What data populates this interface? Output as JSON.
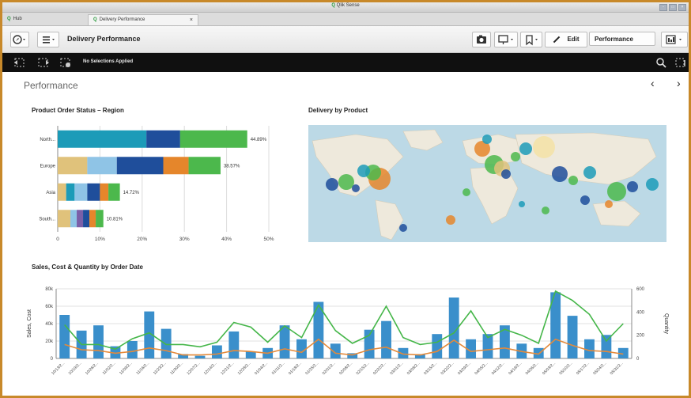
{
  "window": {
    "app_prefix": "Q",
    "app_title": "Qlik Sense",
    "controls": [
      "-",
      "□",
      "×"
    ]
  },
  "tabs": [
    {
      "icon": "Q",
      "label": "Hub"
    },
    {
      "icon": "Q",
      "label": "Delivery Performance",
      "close": "×"
    }
  ],
  "toolbar": {
    "sheet_name": "Delivery Performance",
    "edit_label": "Edit",
    "sheet_selector": "Performance"
  },
  "selections": {
    "message": "No Selections Applied"
  },
  "page": {
    "title": "Performance",
    "prev": "‹",
    "next": "›"
  },
  "colors": {
    "bar_blue": "#3a8fcb",
    "line_green": "#45b649",
    "line_orange": "#e58a3a",
    "segments": [
      "#1c9bb8",
      "#1f4e9b",
      "#4cb84c",
      "#e0c27b",
      "#8fc4e6",
      "#e5862b",
      "#7a5fa8"
    ]
  },
  "chart_data": [
    {
      "type": "bar",
      "orientation": "horizontal-stacked",
      "title": "Product Order Status – Region",
      "categories": [
        "North...",
        "Europe",
        "Asia",
        "South..."
      ],
      "totals_label": [
        "44.89%",
        "38.57%",
        "14.72%",
        "10.81%"
      ],
      "totals": [
        44.89,
        38.57,
        14.72,
        10.81
      ],
      "segments": [
        [
          21,
          8,
          15.89
        ],
        [
          7,
          7,
          11,
          6,
          7.57
        ],
        [
          2,
          2,
          3,
          3,
          2,
          2.72
        ],
        [
          3,
          1.5,
          1.5,
          1.5,
          1.5,
          1.81
        ]
      ],
      "segment_colors": [
        [
          "#1c9bb8",
          "#1f4e9b",
          "#4cb84c"
        ],
        [
          "#e0c27b",
          "#8fc4e6",
          "#1f4e9b",
          "#e5862b",
          "#4cb84c"
        ],
        [
          "#e0c27b",
          "#1c9bb8",
          "#8fc4e6",
          "#1f4e9b",
          "#e5862b",
          "#4cb84c"
        ],
        [
          "#e0c27b",
          "#8fc4e6",
          "#7a5fa8",
          "#1f4e9b",
          "#e5862b",
          "#4cb84c"
        ]
      ],
      "xticks": [
        "0",
        "10%",
        "20%",
        "30%",
        "40%",
        "50%"
      ],
      "xlim": [
        0,
        50
      ],
      "grid": true
    },
    {
      "type": "map",
      "title": "Delivery by Product"
    },
    {
      "type": "combo",
      "title": "Sales, Cost & Quantity by Order Date",
      "ylabel": "Sales, Cost",
      "y2label": "Quantity",
      "yticks": [
        "0",
        "20k",
        "40k",
        "60k",
        "80k"
      ],
      "y2ticks": [
        "0",
        "200",
        "400",
        "600"
      ],
      "ylim": [
        0,
        80000
      ],
      "y2lim": [
        0,
        600
      ],
      "categories": [
        "10/13/2...",
        "10/19/2...",
        "10/26/2...",
        "11/02/2...",
        "11/09/2...",
        "11/16/2...",
        "11/23/2...",
        "11/30/2...",
        "12/07/2...",
        "12/14/2...",
        "12/21/2...",
        "12/28/2...",
        "01/04/2...",
        "01/11/2...",
        "01/18/2...",
        "01/25/2...",
        "02/01/2...",
        "02/08/2...",
        "02/15/2...",
        "02/22/2...",
        "03/01/2...",
        "03/08/2...",
        "03/15/2...",
        "03/22/2...",
        "03/29/2...",
        "04/05/2...",
        "04/12/2...",
        "04/19/2...",
        "04/26/2...",
        "05/03/2...",
        "05/10/2...",
        "05/17/2...",
        "05/24/2...",
        "05/31/2..."
      ],
      "series": [
        {
          "name": "Sales",
          "kind": "bar",
          "values": [
            50000,
            32000,
            38000,
            14000,
            20000,
            54000,
            34000,
            5000,
            3000,
            15000,
            31000,
            8000,
            12000,
            38000,
            22000,
            65000,
            17000,
            6000,
            33000,
            43000,
            12000,
            5000,
            28000,
            70000,
            22000,
            28000,
            38000,
            17000,
            12000,
            76000,
            49000,
            22000,
            27000,
            12000
          ]
        },
        {
          "name": "Cost",
          "kind": "line",
          "axis": "left",
          "values": [
            16000,
            10000,
            9000,
            6000,
            8000,
            12000,
            9000,
            4000,
            4000,
            5000,
            9000,
            8000,
            6000,
            11000,
            7000,
            22000,
            6000,
            4000,
            10000,
            13000,
            5000,
            4000,
            8000,
            21000,
            8000,
            10000,
            12000,
            8000,
            5000,
            22000,
            15000,
            9000,
            8000,
            5000
          ]
        },
        {
          "name": "Quantity",
          "kind": "line",
          "axis": "right",
          "values": [
            290,
            120,
            120,
            80,
            170,
            220,
            120,
            120,
            100,
            140,
            310,
            270,
            140,
            280,
            180,
            460,
            240,
            130,
            200,
            450,
            180,
            120,
            140,
            220,
            410,
            180,
            250,
            200,
            130,
            580,
            500,
            380,
            150,
            300
          ]
        }
      ],
      "grid": true
    }
  ]
}
